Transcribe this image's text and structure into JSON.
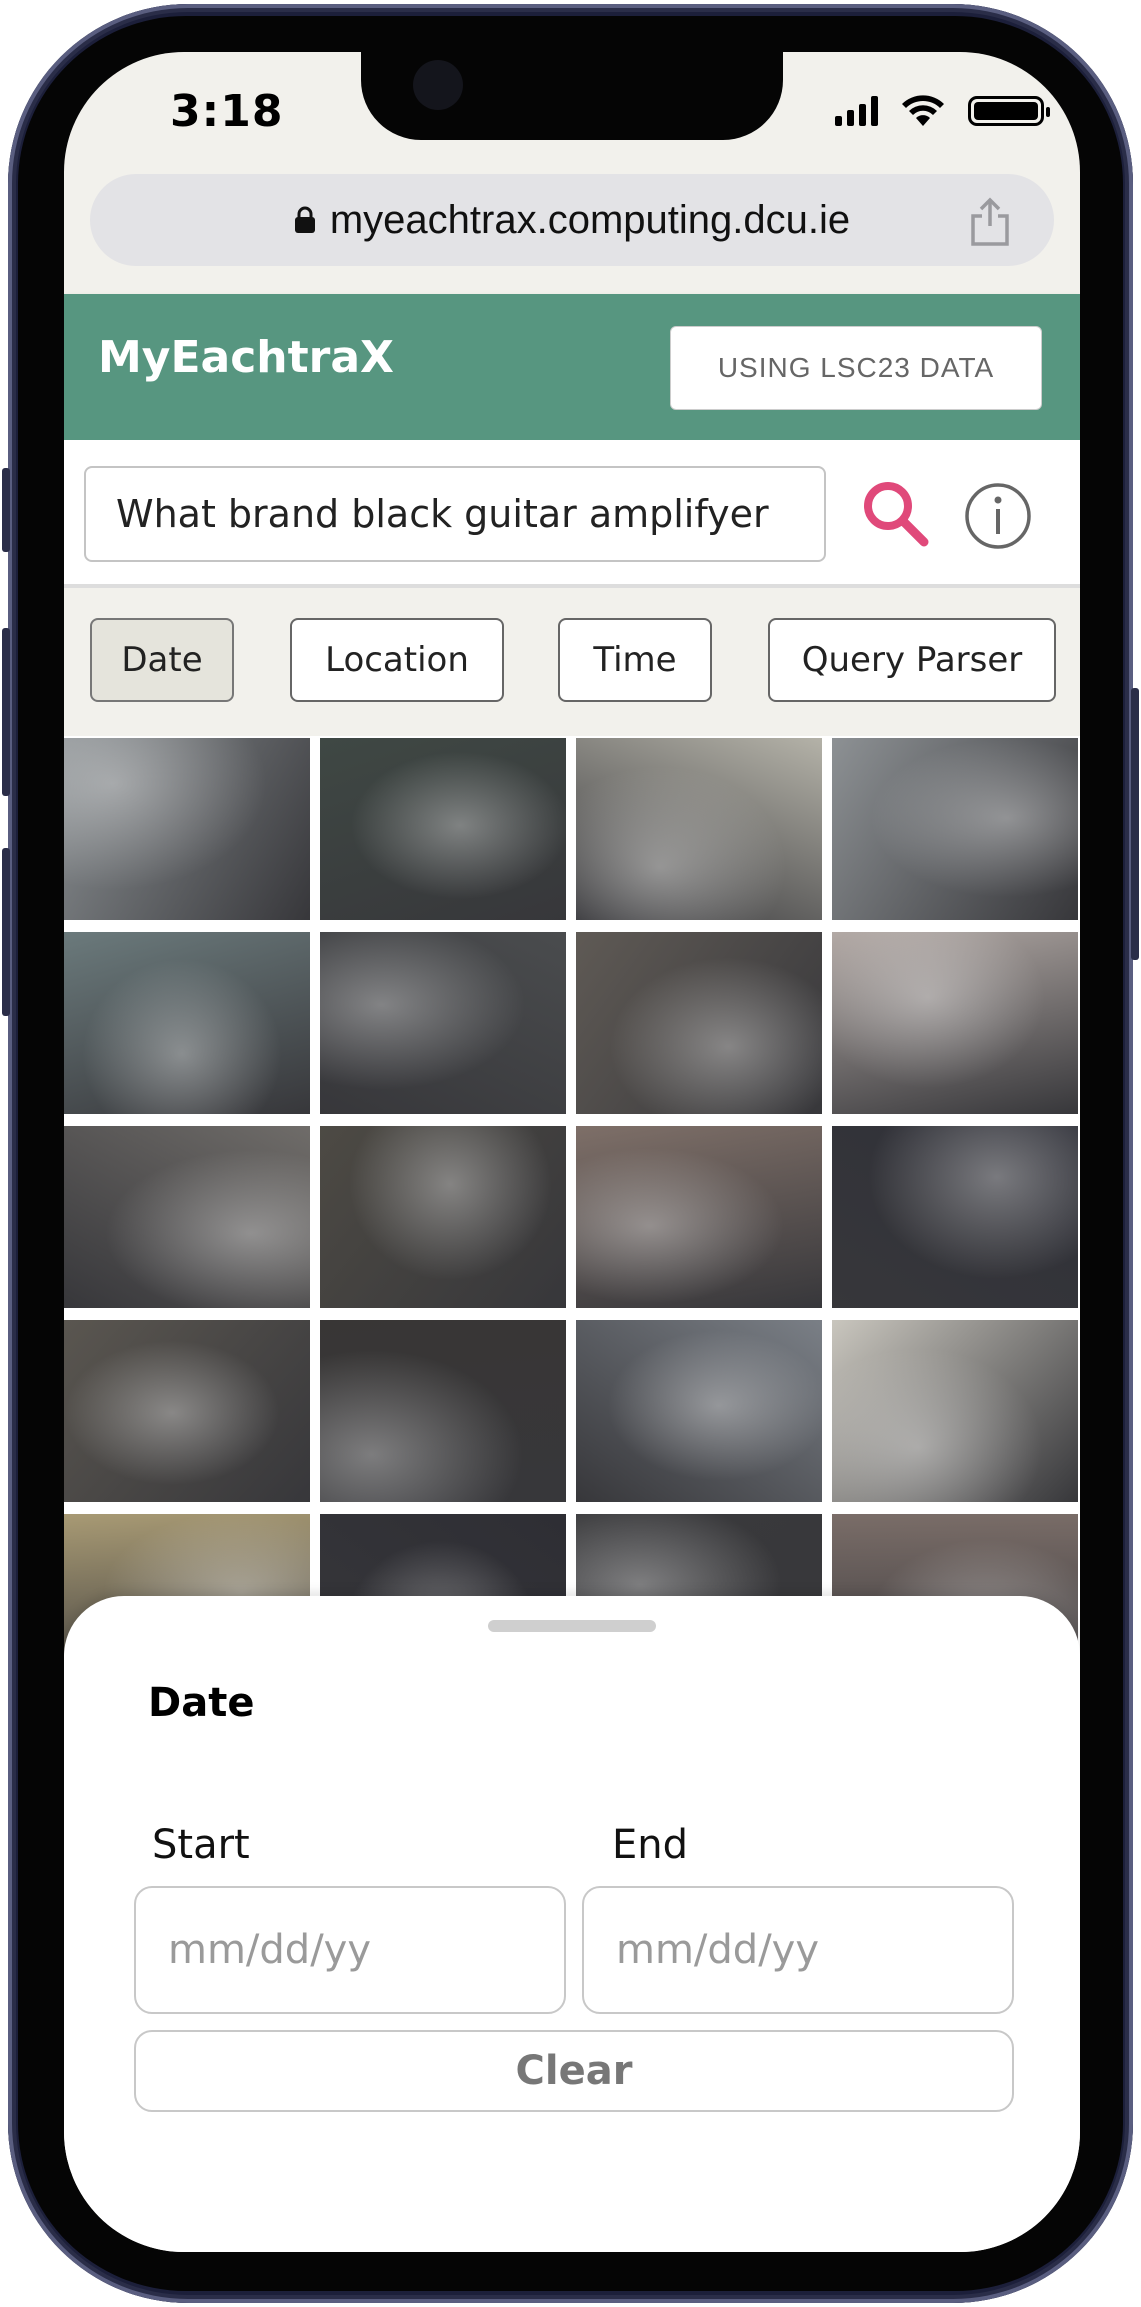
{
  "status": {
    "time": "3:18"
  },
  "browser": {
    "url": "myeachtrax.computing.dcu.ie"
  },
  "app": {
    "title": "MyEachtraX",
    "data_button": "USING LSC23 DATA"
  },
  "search": {
    "query": "What brand black guitar amplifyer"
  },
  "filters": [
    {
      "label": "Date",
      "active": true
    },
    {
      "label": "Location",
      "active": false
    },
    {
      "label": "Time",
      "active": false
    },
    {
      "label": "Query Parser",
      "active": false
    }
  ],
  "images": {
    "rows": 5,
    "columns": 4,
    "colors": [
      "#8a8f92",
      "#3f4844",
      "#b4b2a8",
      "#8d9194",
      "#6b7a7c",
      "#4a4c4e",
      "#5f5a55",
      "#b3aaa6",
      "#6f6c69",
      "#4d4a44",
      "#7e6f68",
      "#2f3038",
      "#5a5650",
      "#383635",
      "#7a7f86",
      "#c9c6be",
      "#a89a74",
      "#2e2e34",
      "#3a3a3c",
      "#7a6d68"
    ]
  },
  "date_sheet": {
    "title": "Date",
    "start_label": "Start",
    "end_label": "End",
    "start_placeholder": "mm/dd/yy",
    "end_placeholder": "mm/dd/yy",
    "clear_label": "Clear"
  }
}
